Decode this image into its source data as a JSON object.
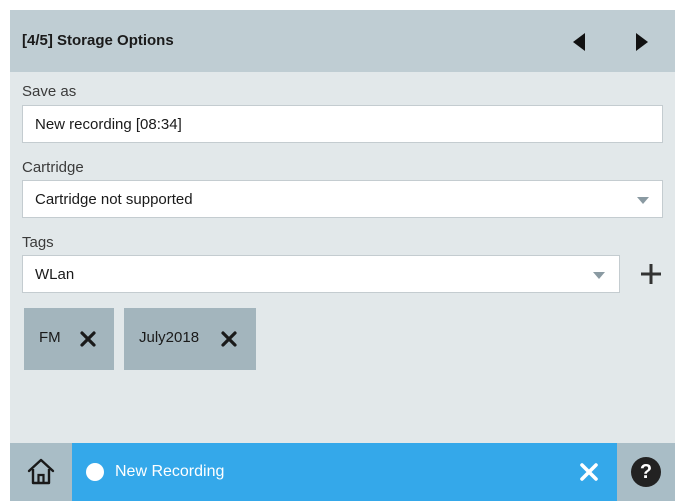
{
  "header": {
    "title": "[4/5] Storage Options",
    "prev_icon": "arrow-left-icon",
    "next_icon": "arrow-right-icon"
  },
  "save_as": {
    "label": "Save as",
    "value": "New recording [08:34]"
  },
  "cartridge": {
    "label": "Cartridge",
    "value": "Cartridge not supported"
  },
  "tags": {
    "label": "Tags",
    "value": "WLan",
    "add_icon": "plus-icon",
    "chips": [
      {
        "label": "FM"
      },
      {
        "label": "July2018"
      }
    ]
  },
  "footer": {
    "home_icon": "home-icon",
    "status_text": "New Recording",
    "close_icon": "close-icon",
    "help_label": "?"
  },
  "colors": {
    "header_bg": "#bfcdd3",
    "panel_bg": "#e2e8ea",
    "footer_bg": "#34a8ea",
    "chip_bg": "#a3b5bd"
  }
}
